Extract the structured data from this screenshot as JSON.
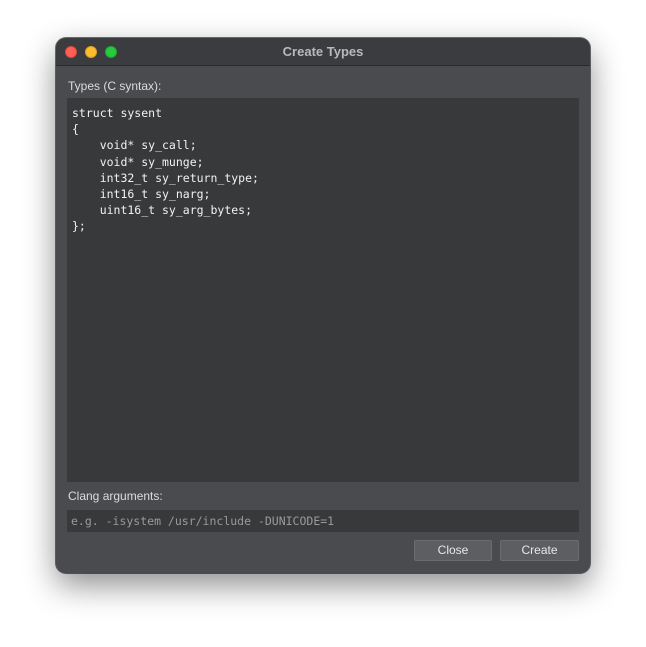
{
  "window": {
    "title": "Create Types"
  },
  "types": {
    "label": "Types (C syntax):",
    "code": "struct sysent\n{\n    void* sy_call;\n    void* sy_munge;\n    int32_t sy_return_type;\n    int16_t sy_narg;\n    uint16_t sy_arg_bytes;\n};"
  },
  "clang": {
    "label": "Clang arguments:",
    "placeholder": "e.g. -isystem /usr/include -DUNICODE=1",
    "value": ""
  },
  "buttons": {
    "close": "Close",
    "create": "Create"
  },
  "colors": {
    "window_bg": "#4a4b4e",
    "editor_bg": "#38393b",
    "traffic_close": "#fe5f57",
    "traffic_minimize": "#febc2e",
    "traffic_maximize": "#28c840"
  }
}
